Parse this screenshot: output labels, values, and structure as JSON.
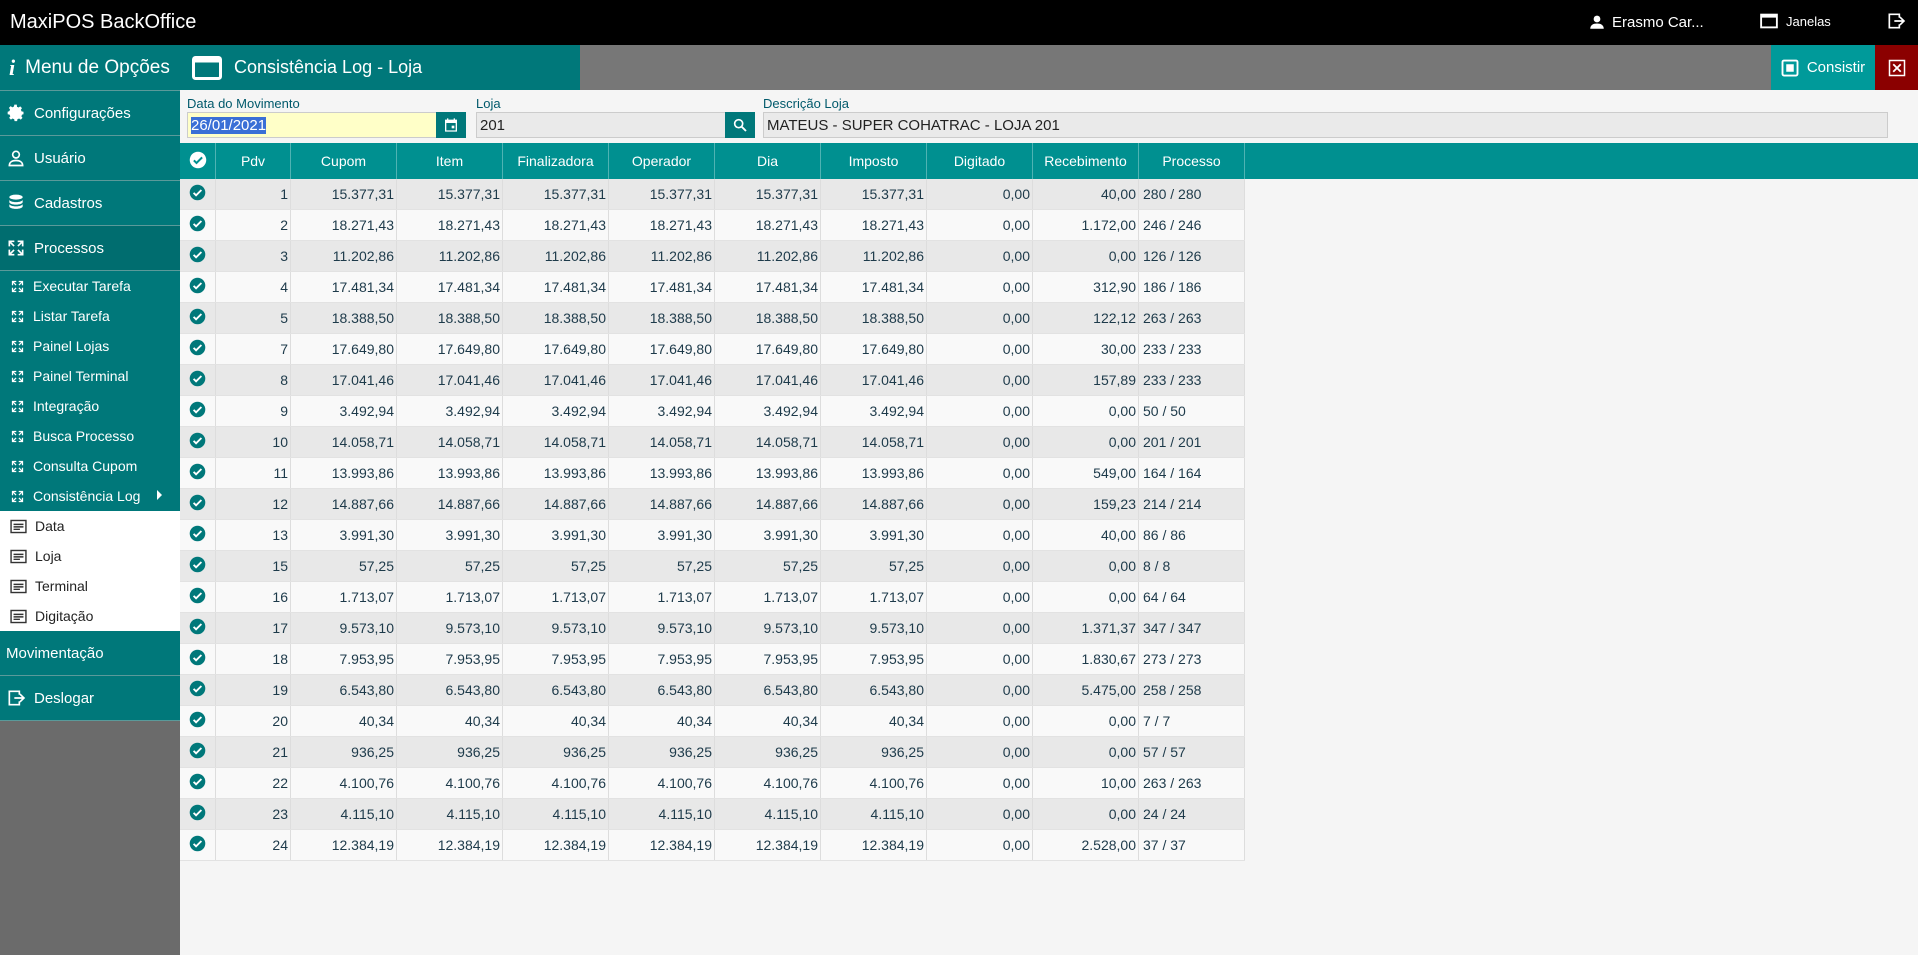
{
  "app": {
    "title": "MaxiPOS BackOffice",
    "user": "Erasmo Car...",
    "windows_label": "Janelas"
  },
  "sidebar": {
    "header": "Menu de Opções",
    "items": [
      {
        "label": "Configurações",
        "icon": "gear-icon"
      },
      {
        "label": "Usuário",
        "icon": "user-icon"
      },
      {
        "label": "Cadastros",
        "icon": "database-icon"
      },
      {
        "label": "Processos",
        "icon": "expand-icon"
      }
    ],
    "processos": [
      "Executar Tarefa",
      "Listar Tarefa",
      "Painel Lojas",
      "Painel Terminal",
      "Integração",
      "Busca Processo",
      "Consulta Cupom",
      "Consistência Log"
    ],
    "consistencia": [
      "Data",
      "Loja",
      "Terminal",
      "Digitação"
    ],
    "movimentacao": "Movimentação",
    "deslogar": "Deslogar"
  },
  "tab": {
    "title": "Consistência Log - Loja"
  },
  "toolbar": {
    "consistir": "Consistir"
  },
  "form": {
    "date_label": "Data do Movimento",
    "date_value": "26/01/2021",
    "loja_label": "Loja",
    "loja_value": "201",
    "desc_label": "Descrição Loja",
    "desc_value": "MATEUS - SUPER COHATRAC - LOJA 201"
  },
  "table": {
    "columns": [
      "Pdv",
      "Cupom",
      "Item",
      "Finalizadora",
      "Operador",
      "Dia",
      "Imposto",
      "Digitado",
      "Recebimento",
      "Processo"
    ],
    "rows": [
      [
        "1",
        "15.377,31",
        "15.377,31",
        "15.377,31",
        "15.377,31",
        "15.377,31",
        "15.377,31",
        "0,00",
        "40,00",
        "280 / 280"
      ],
      [
        "2",
        "18.271,43",
        "18.271,43",
        "18.271,43",
        "18.271,43",
        "18.271,43",
        "18.271,43",
        "0,00",
        "1.172,00",
        "246 / 246"
      ],
      [
        "3",
        "11.202,86",
        "11.202,86",
        "11.202,86",
        "11.202,86",
        "11.202,86",
        "11.202,86",
        "0,00",
        "0,00",
        "126 / 126"
      ],
      [
        "4",
        "17.481,34",
        "17.481,34",
        "17.481,34",
        "17.481,34",
        "17.481,34",
        "17.481,34",
        "0,00",
        "312,90",
        "186 / 186"
      ],
      [
        "5",
        "18.388,50",
        "18.388,50",
        "18.388,50",
        "18.388,50",
        "18.388,50",
        "18.388,50",
        "0,00",
        "122,12",
        "263 / 263"
      ],
      [
        "7",
        "17.649,80",
        "17.649,80",
        "17.649,80",
        "17.649,80",
        "17.649,80",
        "17.649,80",
        "0,00",
        "30,00",
        "233 / 233"
      ],
      [
        "8",
        "17.041,46",
        "17.041,46",
        "17.041,46",
        "17.041,46",
        "17.041,46",
        "17.041,46",
        "0,00",
        "157,89",
        "233 / 233"
      ],
      [
        "9",
        "3.492,94",
        "3.492,94",
        "3.492,94",
        "3.492,94",
        "3.492,94",
        "3.492,94",
        "0,00",
        "0,00",
        "50 / 50"
      ],
      [
        "10",
        "14.058,71",
        "14.058,71",
        "14.058,71",
        "14.058,71",
        "14.058,71",
        "14.058,71",
        "0,00",
        "0,00",
        "201 / 201"
      ],
      [
        "11",
        "13.993,86",
        "13.993,86",
        "13.993,86",
        "13.993,86",
        "13.993,86",
        "13.993,86",
        "0,00",
        "549,00",
        "164 / 164"
      ],
      [
        "12",
        "14.887,66",
        "14.887,66",
        "14.887,66",
        "14.887,66",
        "14.887,66",
        "14.887,66",
        "0,00",
        "159,23",
        "214 / 214"
      ],
      [
        "13",
        "3.991,30",
        "3.991,30",
        "3.991,30",
        "3.991,30",
        "3.991,30",
        "3.991,30",
        "0,00",
        "40,00",
        "86 / 86"
      ],
      [
        "15",
        "57,25",
        "57,25",
        "57,25",
        "57,25",
        "57,25",
        "57,25",
        "0,00",
        "0,00",
        "8 / 8"
      ],
      [
        "16",
        "1.713,07",
        "1.713,07",
        "1.713,07",
        "1.713,07",
        "1.713,07",
        "1.713,07",
        "0,00",
        "0,00",
        "64 / 64"
      ],
      [
        "17",
        "9.573,10",
        "9.573,10",
        "9.573,10",
        "9.573,10",
        "9.573,10",
        "9.573,10",
        "0,00",
        "1.371,37",
        "347 / 347"
      ],
      [
        "18",
        "7.953,95",
        "7.953,95",
        "7.953,95",
        "7.953,95",
        "7.953,95",
        "7.953,95",
        "0,00",
        "1.830,67",
        "273 / 273"
      ],
      [
        "19",
        "6.543,80",
        "6.543,80",
        "6.543,80",
        "6.543,80",
        "6.543,80",
        "6.543,80",
        "0,00",
        "5.475,00",
        "258 / 258"
      ],
      [
        "20",
        "40,34",
        "40,34",
        "40,34",
        "40,34",
        "40,34",
        "40,34",
        "0,00",
        "0,00",
        "7 / 7"
      ],
      [
        "21",
        "936,25",
        "936,25",
        "936,25",
        "936,25",
        "936,25",
        "936,25",
        "0,00",
        "0,00",
        "57 / 57"
      ],
      [
        "22",
        "4.100,76",
        "4.100,76",
        "4.100,76",
        "4.100,76",
        "4.100,76",
        "4.100,76",
        "0,00",
        "10,00",
        "263 / 263"
      ],
      [
        "23",
        "4.115,10",
        "4.115,10",
        "4.115,10",
        "4.115,10",
        "4.115,10",
        "4.115,10",
        "0,00",
        "0,00",
        "24 / 24"
      ],
      [
        "24",
        "12.384,19",
        "12.384,19",
        "12.384,19",
        "12.384,19",
        "12.384,19",
        "12.384,19",
        "0,00",
        "2.528,00",
        "37 / 37"
      ]
    ]
  },
  "colors": {
    "teal": "#00787a",
    "header_teal": "#009090",
    "close_red": "#8b0000",
    "date_bg": "#ffffc8"
  }
}
